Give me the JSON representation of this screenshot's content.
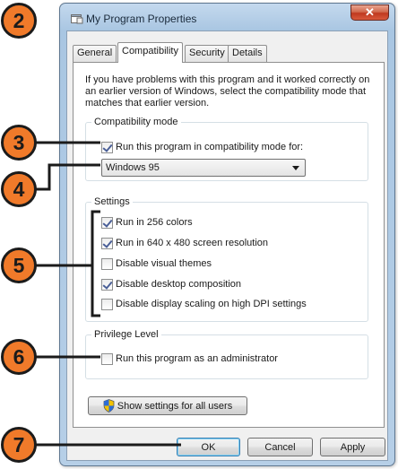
{
  "window": {
    "title": "My Program Properties",
    "close_glyph": "✕"
  },
  "tabs": [
    "General",
    "Compatibility",
    "Security",
    "Details"
  ],
  "active_tab": "Compatibility",
  "intro_text": "If you have problems with this program and it worked correctly on an earlier version of Windows, select the compatibility mode that matches that earlier version.",
  "compat_mode": {
    "group_label": "Compatibility mode",
    "checkbox_label": "Run this program in compatibility mode for:",
    "checked": true,
    "selected_os": "Windows 95"
  },
  "settings": {
    "group_label": "Settings",
    "items": [
      {
        "label": "Run in 256 colors",
        "checked": true
      },
      {
        "label": "Run in 640 x 480 screen resolution",
        "checked": true
      },
      {
        "label": "Disable visual themes",
        "checked": false
      },
      {
        "label": "Disable desktop composition",
        "checked": true
      },
      {
        "label": "Disable display scaling on high DPI settings",
        "checked": false
      }
    ]
  },
  "privilege": {
    "group_label": "Privilege Level",
    "checkbox_label": "Run this program as an administrator",
    "checked": false
  },
  "all_users_button": "Show settings for all users",
  "buttons": {
    "ok": "OK",
    "cancel": "Cancel",
    "apply": "Apply"
  },
  "callouts": [
    "2",
    "3",
    "4",
    "5",
    "6",
    "7"
  ],
  "colors": {
    "callout_fill": "#f07a2a",
    "callout_stroke": "#1b1b1b",
    "title_bar": "#b6cfe7"
  },
  "icons": {
    "window": "program-window-icon",
    "close": "close-icon",
    "shield": "uac-shield-icon",
    "dropdown": "chevron-down-icon"
  }
}
